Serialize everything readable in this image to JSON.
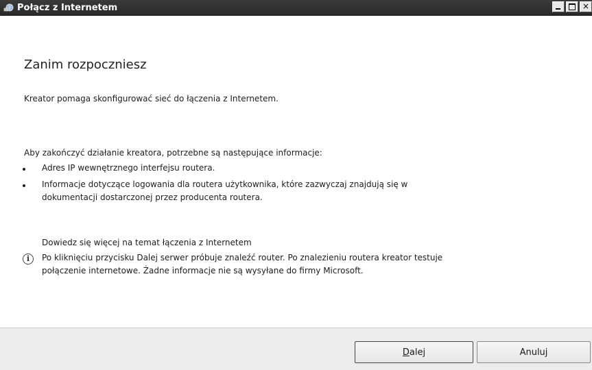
{
  "window": {
    "title": "Połącz z Internetem"
  },
  "content": {
    "heading": "Zanim rozpoczniesz",
    "intro": "Kreator pomaga skonfigurować sieć do łączenia z Internetem.",
    "requirements_intro": "Aby zakończyć działanie kreatora, potrzebne są następujące informacje:",
    "bullets": [
      {
        "line1": "Adres IP wewnętrznego interfejsu routera."
      },
      {
        "line1": "Informacje dotyczące logowania dla routera użytkownika, które zazwyczaj znajdują się w",
        "line2": "dokumentacji dostarczonej przez producenta routera."
      }
    ],
    "link": "Dowiedz się więcej na temat łączenia z Internetem",
    "info_line1": "Po kliknięciu przycisku Dalej serwer próbuje znaleźć router. Po znalezieniu routera kreator testuje",
    "info_line2": "połączenie internetowe. Żadne informacje nie są wysyłane do firmy Microsoft.",
    "info_icon": "info-icon"
  },
  "buttons": {
    "next_mnemonic": "D",
    "next_rest": "alej",
    "cancel": "Anuluj"
  },
  "title_controls": {
    "close_glyph": "×"
  }
}
